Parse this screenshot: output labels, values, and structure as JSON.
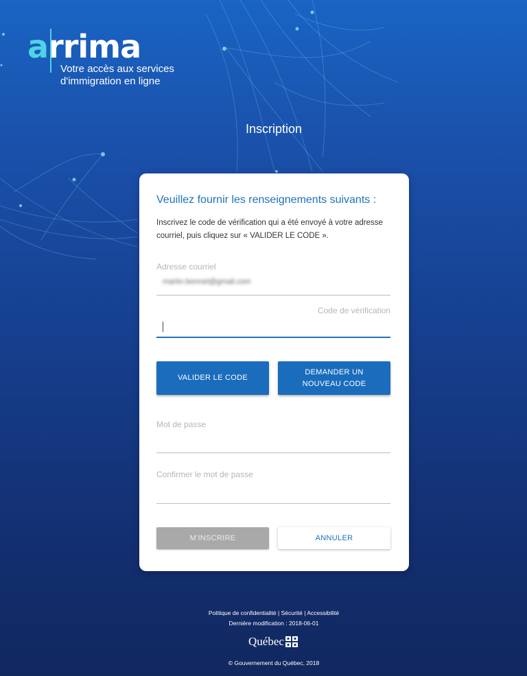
{
  "brand": {
    "logo_text": "arrima",
    "tagline": "Votre accès aux services d'immigration en ligne"
  },
  "page": {
    "heading": "Inscription"
  },
  "form": {
    "title": "Veuillez fournir les renseignements suivants :",
    "instructions": "Inscrivez le code de vérification qui a été envoyé à votre adresse courriel, puis cliquez sur « VALIDER LE CODE ».",
    "email_label": "Adresse courriel",
    "email_value": "martin.bonnet@gmail.com",
    "code_label": "Code de vérification",
    "code_value": "",
    "validate_button": "VALIDER LE CODE",
    "new_code_button": "DEMANDER UN NOUVEAU CODE",
    "password_label": "Mot de passe",
    "confirm_password_label": "Confirmer le mot de passe",
    "register_button": "M'INSCRIRE",
    "cancel_button": "ANNULER"
  },
  "footer": {
    "link_privacy": "Politique de confidentialité",
    "link_security": "Sécurité",
    "link_accessibility": "Accessibilité",
    "separator": "|",
    "last_modified": "Dernière modification : 2018-06-01",
    "gov_logo_text": "Québec",
    "copyright": "© Gouvernement du Québec, 2018"
  },
  "colors": {
    "accent": "#1c72bd",
    "logo_accent": "#4fd3e6",
    "background_top": "#1a64c4",
    "background_bottom": "#11285f",
    "disabled_button": "#a9a9a9"
  },
  "icons": {
    "gov_flag": "quebec-fleur-de-lis-flag-icon"
  }
}
